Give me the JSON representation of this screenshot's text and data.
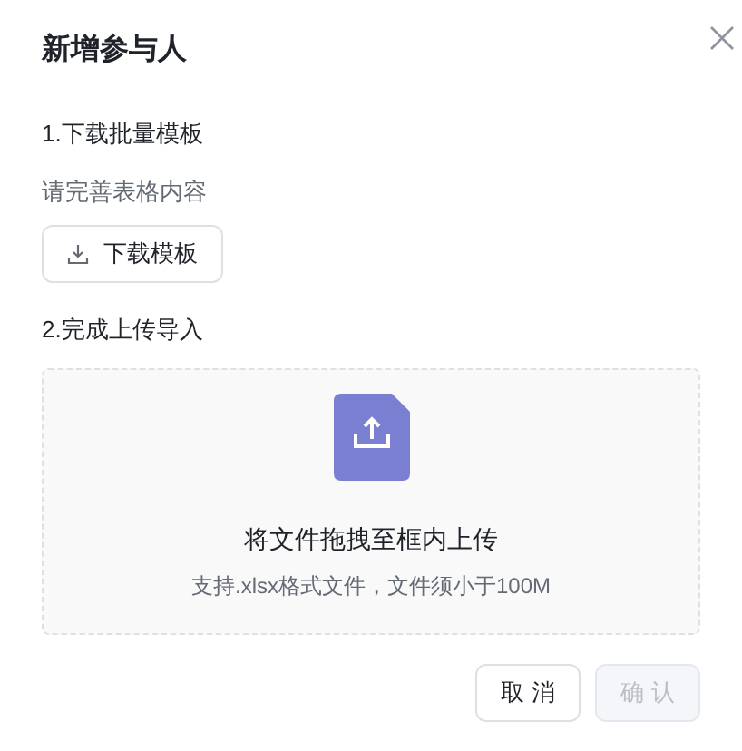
{
  "dialog": {
    "title": "新增参与人"
  },
  "step1": {
    "heading": "1.下载批量模板",
    "hint": "请完善表格内容",
    "download_button": "下载模板"
  },
  "step2": {
    "heading": "2.完成上传导入",
    "dropzone": {
      "title": "将文件拖拽至框内上传",
      "hint": "支持.xlsx格式文件，文件须小于100M"
    }
  },
  "buttons": [
    {
      "label": "取 消",
      "disabled": false
    },
    {
      "label": "确 认",
      "disabled": true
    }
  ]
}
